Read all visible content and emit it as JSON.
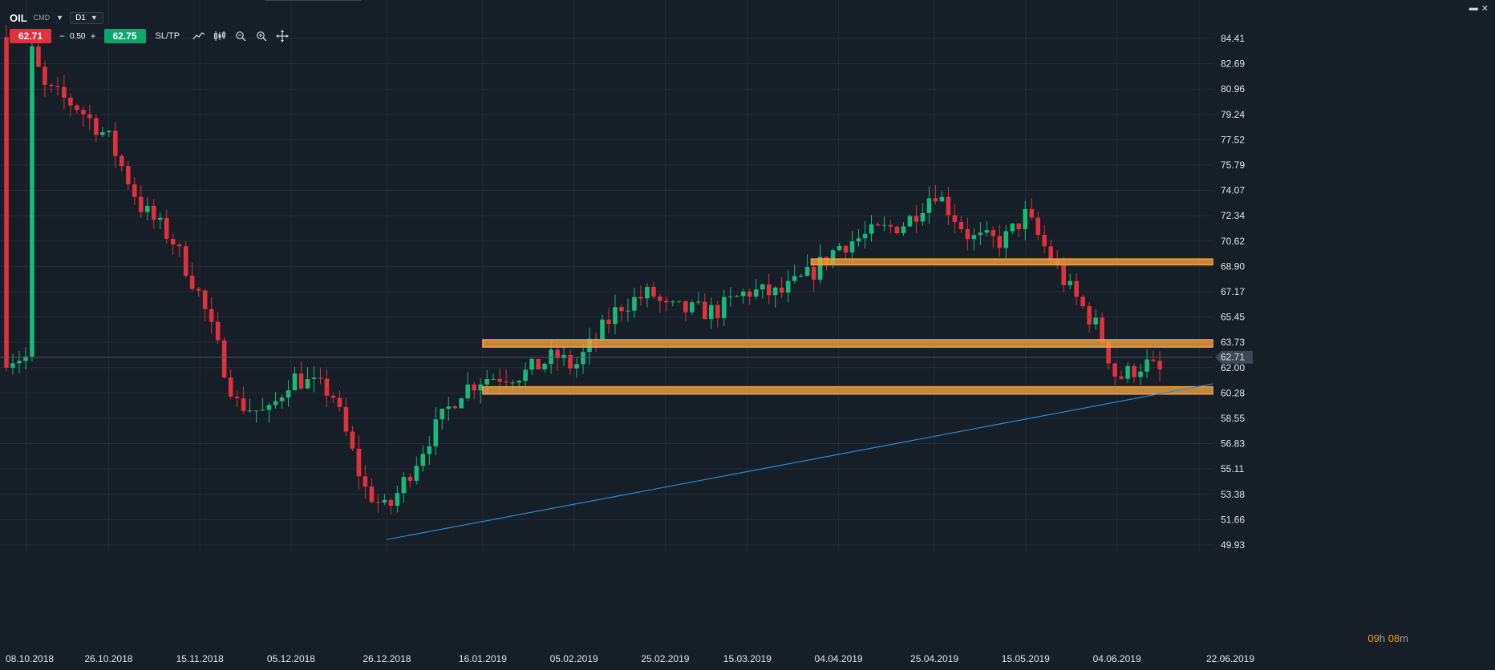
{
  "toolbar": {
    "symbol": "OIL",
    "instrument_type": "CMD",
    "timeframe": "D1",
    "sell_price": "62.71",
    "volume_minus": "−",
    "volume": "0.50",
    "volume_plus": "+",
    "buy_price": "62.75",
    "sltp_label": "SL/TP",
    "icons": [
      "line-chart-icon",
      "candles-icon",
      "zoom-out-icon",
      "zoom-in-icon",
      "crosshair-icon"
    ]
  },
  "window": {
    "minimize": "▬",
    "close": "✕"
  },
  "timer": {
    "hours": "09",
    "h_unit": "h",
    "minutes": "08",
    "m_unit": "m"
  },
  "colors": {
    "background": "#161e27",
    "grid": "#232e39",
    "bull": "#19b97a",
    "bear": "#e0313c",
    "zone": "#f2a03d",
    "trendline": "#2a8ad6",
    "price_line": "#4c5966"
  },
  "chart_data": {
    "type": "candlestick",
    "symbol": "OIL",
    "timeframe": "D1",
    "current_price": 62.71,
    "current_price_label": "62.71",
    "y_ticks": [
      "84.41",
      "82.69",
      "80.96",
      "79.24",
      "77.52",
      "75.79",
      "74.07",
      "72.34",
      "70.62",
      "68.90",
      "67.17",
      "65.45",
      "63.73",
      "62.00",
      "60.28",
      "58.55",
      "56.83",
      "55.11",
      "53.38",
      "51.66",
      "49.93"
    ],
    "x_ticks": [
      "08.10.2018",
      "26.10.2018",
      "15.11.2018",
      "05.12.2018",
      "26.12.2018",
      "16.01.2019",
      "05.02.2019",
      "25.02.2019",
      "15.03.2019",
      "04.04.2019",
      "25.04.2019",
      "15.05.2019",
      "04.06.2019",
      "22.06.2019"
    ],
    "ylim": [
      49.93,
      84.41
    ],
    "xlim": [
      "08.10.2018",
      "22.06.2019"
    ],
    "close_path": [
      [
        "08.10.2018",
        84.5
      ],
      [
        "12.10.2018",
        81.0
      ],
      [
        "19.10.2018",
        79.8
      ],
      [
        "26.10.2018",
        77.6
      ],
      [
        "02.11.2018",
        73.0
      ],
      [
        "09.11.2018",
        70.7
      ],
      [
        "15.11.2018",
        66.9
      ],
      [
        "23.11.2018",
        59.6
      ],
      [
        "30.11.2018",
        58.8
      ],
      [
        "05.12.2018",
        61.4
      ],
      [
        "14.12.2018",
        60.3
      ],
      [
        "21.12.2018",
        53.8
      ],
      [
        "26.12.2018",
        52.2
      ],
      [
        "04.01.2019",
        57.1
      ],
      [
        "11.01.2019",
        60.4
      ],
      [
        "16.01.2019",
        61.3
      ],
      [
        "25.01.2019",
        61.6
      ],
      [
        "01.02.2019",
        62.8
      ],
      [
        "05.02.2019",
        62.0
      ],
      [
        "15.02.2019",
        66.2
      ],
      [
        "22.02.2019",
        67.1
      ],
      [
        "25.02.2019",
        66.0
      ],
      [
        "08.03.2019",
        65.8
      ],
      [
        "15.03.2019",
        67.2
      ],
      [
        "22.03.2019",
        67.0
      ],
      [
        "29.03.2019",
        68.4
      ],
      [
        "04.04.2019",
        70.3
      ],
      [
        "12.04.2019",
        71.2
      ],
      [
        "19.04.2019",
        71.9
      ],
      [
        "25.04.2019",
        74.1
      ],
      [
        "03.05.2019",
        70.8
      ],
      [
        "10.05.2019",
        70.6
      ],
      [
        "15.05.2019",
        72.4
      ],
      [
        "24.05.2019",
        67.6
      ],
      [
        "31.05.2019",
        64.6
      ],
      [
        "04.06.2019",
        61.2
      ],
      [
        "10.06.2019",
        62.3
      ],
      [
        "14.06.2019",
        61.6
      ],
      [
        "22.06.2019",
        62.7
      ]
    ],
    "zones": [
      {
        "start": "29.03.2019",
        "end": "22.06.2019",
        "upper": 69.4,
        "lower": 69.0
      },
      {
        "start": "16.01.2019",
        "end": "22.06.2019",
        "upper": 63.9,
        "lower": 63.4
      },
      {
        "start": "16.01.2019",
        "end": "22.06.2019",
        "upper": 60.7,
        "lower": 60.2
      }
    ],
    "trendline": {
      "from": [
        "26.12.2018",
        50.3
      ],
      "to": [
        "22.06.2019",
        60.9
      ]
    },
    "grid": true
  }
}
